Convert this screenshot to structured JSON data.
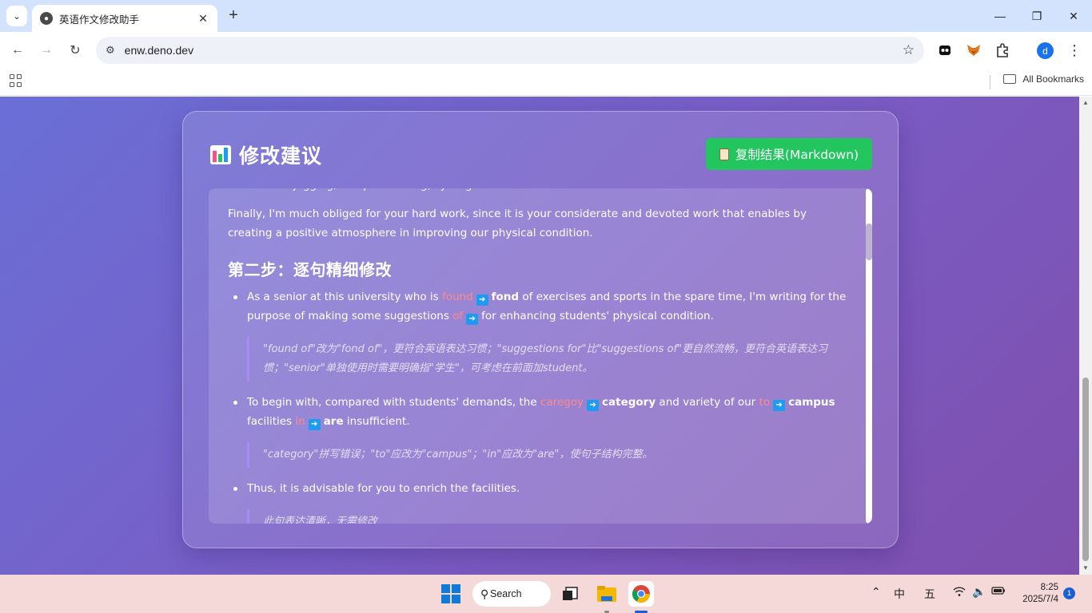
{
  "browser": {
    "tab_title": "英语作文修改助手",
    "url": "enw.deno.dev",
    "all_bookmarks": "All Bookmarks",
    "avatar_letter": "d",
    "window_minimize": "—",
    "window_restore": "❐",
    "window_close": "✕"
  },
  "card": {
    "title": "修改建议",
    "copy_button": "复制结果(Markdown)"
  },
  "result": {
    "clipped_line": "such as the jogging, campus walking, cycling etc.",
    "finally_paragraph": "Finally, I'm much obliged for your hard work, since it is your considerate and devoted work that enables by creating a positive atmosphere in improving our physical condition.",
    "step2_heading": "第二步：逐句精细修改",
    "items": [
      {
        "segments": {
          "t1": "As a senior at this university who is ",
          "w1": "found",
          "r1": "fond",
          "t2": " of exercises and sports in the spare time, I'm writing for the purpose of making some suggestions ",
          "w2": "of",
          "r2": "for",
          "t3": " enhancing students' physical condition."
        },
        "note": "\"found of\"改为\"fond of\"，更符合英语表达习惯；\"suggestions for\"比\"suggestions of\"更自然流畅，更符合英语表达习惯；\"senior\"单独使用时需要明确指\"学生\"，可考虑在前面加student。"
      },
      {
        "segments": {
          "t1": "To begin with, compared with students' demands, the ",
          "w1": "caregoy",
          "r1": "category",
          "t2": " and variety of our ",
          "w2": "to",
          "r2": "campus",
          "t3": " facilities ",
          "w3": "in",
          "r3": "are",
          "t4": " insufficient."
        },
        "note": "\"category\"拼写错误；\"to\"应改为\"campus\"；\"in\"应改为\"are\"，使句子结构完整。"
      },
      {
        "segments": {
          "t1": "Thus, it is advisable for you to enrich the facilities."
        },
        "note": "此句表达清晰，无需修改"
      }
    ]
  },
  "taskbar": {
    "search": "Search",
    "ime_1": "中",
    "ime_2": "五",
    "time": "8:25",
    "date": "2025/7/4",
    "notifications": "1"
  },
  "colors": {
    "accent_green": "#22c55e",
    "wrong_red": "#ff8a8a",
    "arrow_blue": "#1d9bf0"
  }
}
